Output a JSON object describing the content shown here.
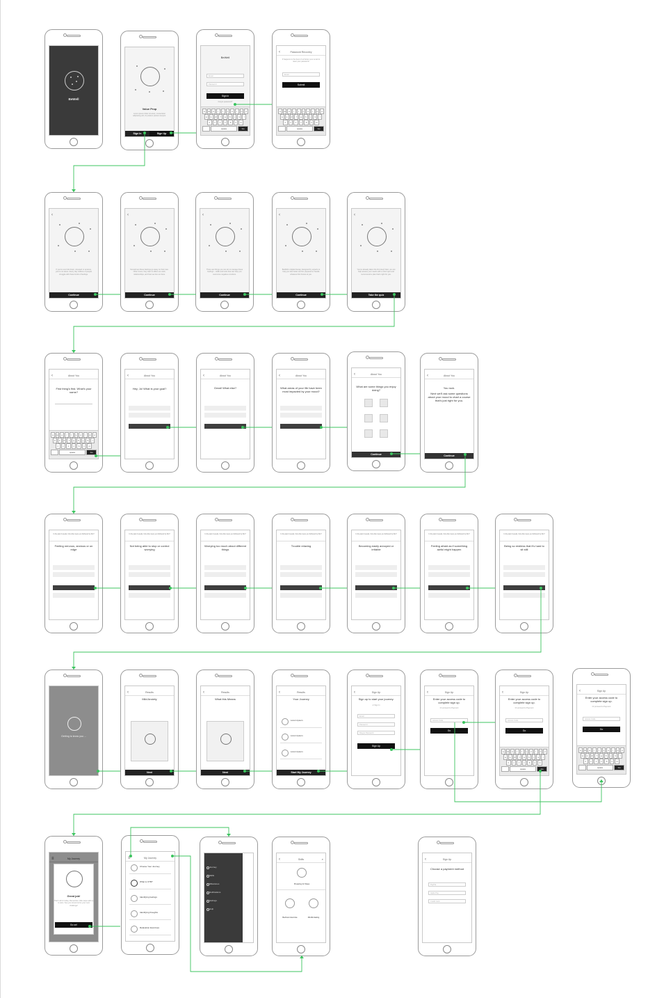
{
  "app_name": "BeWell",
  "accent_color": "#3cc45f",
  "screens": {
    "splash": {
      "app": "BeWell"
    },
    "value_prop": {
      "title": "Value Prop",
      "body": "Lorem ipsum dolor sit amet, consectetur adipiscing elit, Ut pretium pretium tempor.",
      "sign_in": "Sign In",
      "sign_up": "Sign Up"
    },
    "sign_in": {
      "title": "BeWell",
      "email": "Email",
      "password": "Password",
      "button": "Sign in",
      "forgot": "Forgot password?"
    },
    "recovery": {
      "title": "Password Recovery",
      "body": "If happens to the best of us! Enter your email to reset your password.",
      "email": "Email",
      "button": "Submit"
    },
    "onboarding": [
      {
        "body": "If you've ever felt down, stressed or anxious, you're not alone. Every day millions of people struggle with these kinds of feelings.",
        "button": "Continue"
      },
      {
        "body": "Sometimes these feelings go away on their own. Other times, they start to affect our work, relationships, and how we live our lives.",
        "button": "Continue"
      },
      {
        "body": "There are things you can do to manage these feelings – skills and tools that can help you overcome negative emotions.",
        "button": "Continue"
      },
      {
        "body": "BeWell is digital therapy designed by experts to help you feel better and be prepared to handle whatever life throws at you.",
        "button": "Continue"
      },
      {
        "body": "You've already taken the first step! Next, we can help assess your needs with a short quiz and recommend a plan that's right for you.",
        "button": "Take the quiz"
      }
    ],
    "about": {
      "nav_title": "About You",
      "q_name": "First thing's first. What's your name?",
      "q_goal": "Hey, Jo! What is your goal?",
      "q_else": "Great! What else?",
      "q_areas": "What areas of your life have been most impacted by your mood?",
      "q_enjoy": "What are some things you enjoy doing?",
      "rock": "You rock.",
      "rock_body": "Next we'll ask some questions about your mood to chart a course that's just right for you.",
      "continue": "Continue"
    },
    "quiz": {
      "header": "In the past 2 weeks, how often were you bothered by this?",
      "items": [
        "Feeling nervous, anxious or on edge",
        "Not being able to stop or control worrying",
        "Worrying too much about different things",
        "Trouble relaxing",
        "Becoming easily annoyed or irritable",
        "Feeling afraid as if something awful might happen",
        "Being so restless that it's hard to sit still"
      ]
    },
    "results": {
      "loading": "Getting to know you ...",
      "nav_title": "Results",
      "mild": "Mild Anxiety",
      "means": "What this Means",
      "journey": "Your Journey",
      "next": "Next",
      "start": "Start My Journey",
      "journey_items": [
        "Lorem Ipsum",
        "Lorem Ipsum",
        "Lorem Ipsum"
      ]
    },
    "signup": {
      "nav_title": "Sign Up",
      "title": "Sign up to start your journey.",
      "or": "or Sign In",
      "email": "Email",
      "password": "Password",
      "retype": "Retype Password",
      "button": "Sign Up",
      "access_title": "Enter your access code to complete sign up.",
      "or_payment": "Or proceed to Payment",
      "access_code": "Access Code",
      "go": "Go"
    },
    "journey": {
      "nav_title": "My Journey",
      "great": "Great job!",
      "great_body": "That's all for today. Remember, little steps add up to wins. See you tomorrow for your next challenge!",
      "go_next": "Go on!",
      "items": [
        "Choose Your Journey",
        "What is CTB?",
        "Identifying feelings",
        "Identifying thoughts",
        "Relaxation Exercises"
      ]
    },
    "menu": {
      "items": [
        "Journey",
        "Skills",
        "Milestones",
        "Notifications",
        "Settings",
        "Help"
      ]
    },
    "skills": {
      "nav_title": "Skills",
      "items": [
        "Preparing for Sleep",
        "Bedroom Exercise",
        "Mindful Eating"
      ]
    },
    "payment": {
      "nav_title": "Sign Up",
      "title": "Choose a payment method",
      "options": [
        "PayPal",
        "Apple Pay",
        "Credit Card"
      ]
    }
  },
  "keyboard": {
    "row1": [
      "q",
      "w",
      "e",
      "r",
      "t",
      "y",
      "u",
      "i",
      "o",
      "p"
    ],
    "row2": [
      "a",
      "s",
      "d",
      "f",
      "g",
      "h",
      "j",
      "k",
      "l"
    ],
    "row3": [
      "z",
      "x",
      "c",
      "v",
      "b",
      "n",
      "m"
    ],
    "space": "space",
    "go": "Go"
  }
}
